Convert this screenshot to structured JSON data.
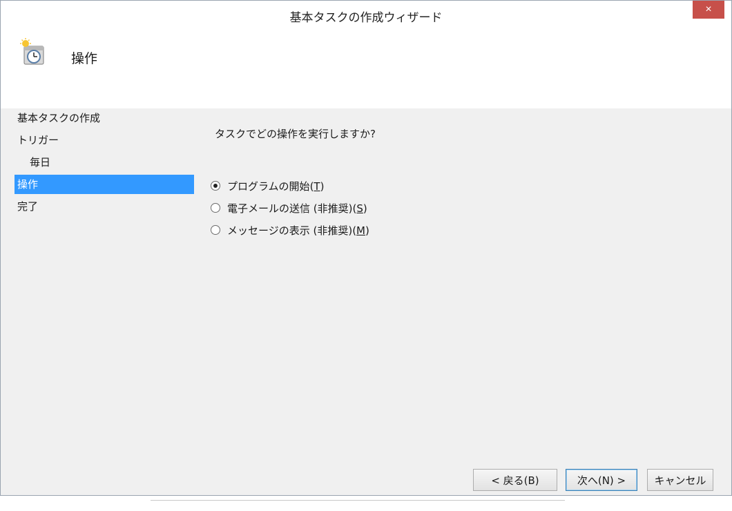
{
  "window": {
    "title": "基本タスクの作成ウィザード",
    "close_label": "×"
  },
  "header": {
    "title": "操作",
    "icon": "task-clock-icon"
  },
  "sidebar": {
    "items": [
      {
        "label": "基本タスクの作成"
      },
      {
        "label": "トリガー"
      },
      {
        "label": "毎日"
      },
      {
        "label": "操作"
      },
      {
        "label": "完了"
      }
    ],
    "active_index": 3
  },
  "content": {
    "question": "タスクでどの操作を実行しますか?",
    "options": [
      {
        "label": "プログラムの開始",
        "accel_open": "(",
        "accel": "T",
        "accel_close": ")",
        "checked": true
      },
      {
        "label": "電子メールの送信 (非推奨)",
        "accel_open": "(",
        "accel": "S",
        "accel_close": ")",
        "checked": false
      },
      {
        "label": "メッセージの表示 (非推奨)",
        "accel_open": "(",
        "accel": "M",
        "accel_close": ")",
        "checked": false
      }
    ]
  },
  "buttons": {
    "back": "< 戻る(B)",
    "next": "次へ(N) >",
    "cancel": "キャンセル"
  },
  "colors": {
    "selection": "#3399ff",
    "close": "#c7504a"
  }
}
